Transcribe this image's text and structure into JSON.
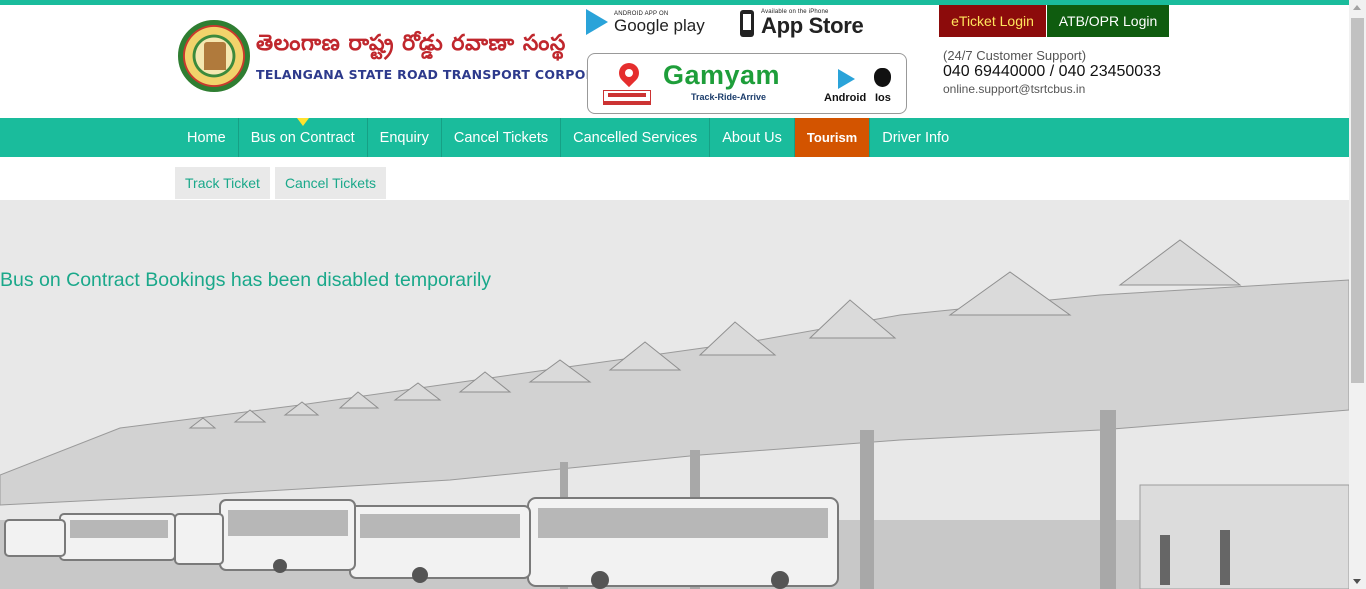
{
  "header": {
    "logo_telugu": "తెలంగాణ  రాష్ట్ర రోడ్డు రవాణా సంస్థ",
    "logo_english": "TELANGANA STATE ROAD TRANSPORT CORPORATION",
    "google_play_small": "ANDROID APP ON",
    "google_play_big": "Google play",
    "app_store_small": "Available on the iPhone",
    "app_store_big": "App Store",
    "gamyam": {
      "title": "Gamyam",
      "tagline": "Track-Ride-Arrive",
      "android_label": "Android",
      "ios_label": "Ios"
    },
    "eticket_login": "eTicket Login",
    "atb_login": "ATB/OPR Login",
    "support_label": "(24/7 Customer Support)",
    "support_phone": "040 69440000 / 040 23450033",
    "support_email": "online.support@tsrtcbus.in"
  },
  "nav": {
    "items": [
      {
        "label": "Home"
      },
      {
        "label": "Bus on Contract"
      },
      {
        "label": "Enquiry"
      },
      {
        "label": "Cancel Tickets"
      },
      {
        "label": "Cancelled Services"
      },
      {
        "label": "About Us"
      },
      {
        "label": "Tourism"
      },
      {
        "label": "Driver Info"
      }
    ],
    "active_index": 1
  },
  "subnav": {
    "items": [
      {
        "label": "Track Ticket"
      },
      {
        "label": "Cancel Tickets"
      }
    ]
  },
  "main": {
    "message": "Bus on Contract Bookings has been disabled temporarily"
  },
  "colors": {
    "accent": "#1abc9c",
    "eticket_bg": "#8c0b0b",
    "eticket_text": "#ffe45c",
    "atb_bg": "#0f5c0f",
    "tourism_bg": "#d35400",
    "message_text": "#1aa88a"
  }
}
